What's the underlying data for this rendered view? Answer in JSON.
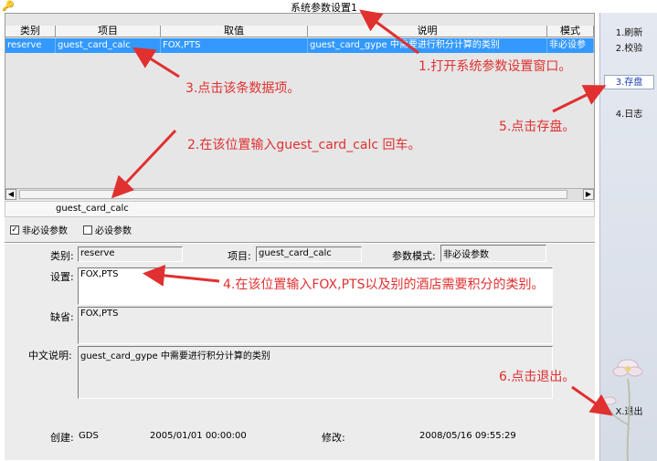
{
  "window": {
    "title": "系统参数设置1"
  },
  "grid": {
    "columns": [
      "类别",
      "项目",
      "取值",
      "说明",
      "模式"
    ],
    "selected_row": [
      "reserve",
      "guest_card_calc",
      "FOX,PTS",
      "guest_card_gype 中需要进行积分计算的类别",
      "非必设参"
    ]
  },
  "crumb": "guest_card_calc",
  "checks": {
    "optional": "非必设参数",
    "required": "必设参数"
  },
  "form": {
    "category_label": "类别:",
    "category_value": "reserve",
    "item_label": "项目:",
    "item_value": "guest_card_calc",
    "mode_label": "参数模式:",
    "mode_value": "非必设参数",
    "setting_label": "设置:",
    "setting_value": "FOX,PTS",
    "default_label": "缺省:",
    "default_value": "FOX,PTS",
    "desc_label": "中文说明:",
    "desc_value": "guest_card_gype 中需要进行积分计算的类别",
    "created_label": "创建:",
    "created_by": "GDS",
    "created_time": "2005/01/01 00:00:00",
    "modified_label": "修改:",
    "modified_time": "2008/05/16 09:55:29"
  },
  "sidebar": {
    "refresh": "1.刷新",
    "verify": "2.校验",
    "save": "3.存盘",
    "log": "4.日志",
    "exit": "X.退出"
  },
  "annotations": {
    "a1": "1.打开系统参数设置窗口。",
    "a2": "2.在该位置输入guest_card_calc 回车。",
    "a3": "3.点击该条数据项。",
    "a4": "4.在该位置输入FOX,PTS以及别的酒店需要积分的类别。",
    "a5": "5.点击存盘。",
    "a6": "6.点击退出。"
  },
  "colors": {
    "selection": "#3399ff",
    "annotation": "#e03030",
    "save_text": "#1a3db5"
  }
}
